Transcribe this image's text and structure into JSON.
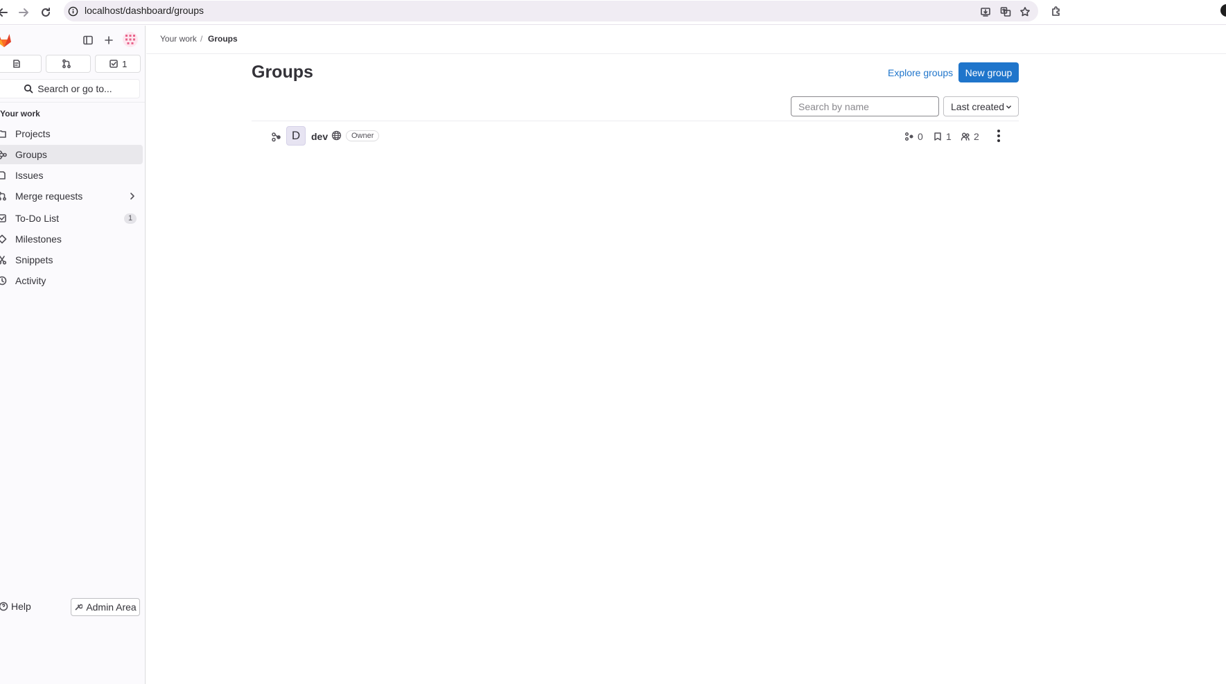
{
  "browser": {
    "url": "localhost/dashboard/groups"
  },
  "sidebar": {
    "counters": [
      {
        "name": "issues",
        "count": ""
      },
      {
        "name": "merge-requests",
        "count": ""
      },
      {
        "name": "todos",
        "count": "1"
      }
    ],
    "search_label": "Search or go to...",
    "section_title": "Your work",
    "items": [
      {
        "label": "Projects",
        "icon": "project-icon"
      },
      {
        "label": "Groups",
        "icon": "group-icon",
        "active": true
      },
      {
        "label": "Issues",
        "icon": "issues-icon"
      },
      {
        "label": "Merge requests",
        "icon": "merge-request-icon"
      },
      {
        "label": "To-Do List",
        "icon": "todo-icon",
        "badge": "1"
      },
      {
        "label": "Milestones",
        "icon": "milestone-icon"
      },
      {
        "label": "Snippets",
        "icon": "snippet-icon"
      },
      {
        "label": "Activity",
        "icon": "history-icon"
      }
    ],
    "help_label": "Help",
    "admin_label": "Admin Area"
  },
  "breadcrumb": {
    "parent": "Your work",
    "current": "Groups"
  },
  "main": {
    "title": "Groups",
    "explore_label": "Explore groups",
    "new_group_label": "New group",
    "search_placeholder": "Search by name",
    "sort_label": "Last created"
  },
  "groups": [
    {
      "avatar_letter": "D",
      "name": "dev",
      "role": "Owner",
      "subgroups": "0",
      "projects": "1",
      "members": "2"
    }
  ],
  "colors": {
    "primary": "#1f75cb",
    "sidebar_bg": "#fbfafd",
    "active_item": "#e9e8ec"
  }
}
